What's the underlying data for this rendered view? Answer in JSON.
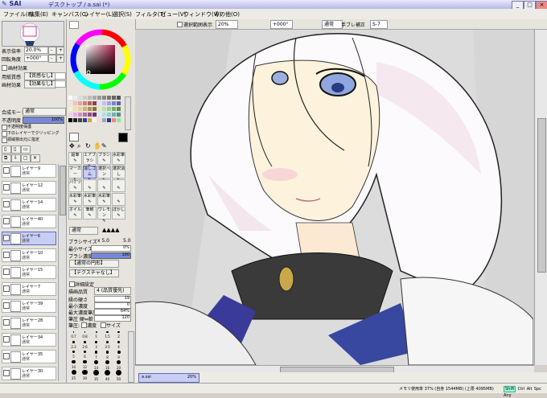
{
  "app": {
    "name": "SAI",
    "document_title": "デスクトップ / a.sai (*)",
    "window_buttons": [
      "_",
      "□",
      "×"
    ]
  },
  "menu": [
    "ファイル(F)",
    "編集(E)",
    "キャンバス(C)",
    "レイヤー(L)",
    "選択(S)",
    "フィルタ(T)",
    "ビュー(V)",
    "ウィンドウ(W)",
    "その他(O)"
  ],
  "toolbar": {
    "selection_outline_label": "選択範囲表示",
    "zoom_value": "20%",
    "rotation_value": "+000°",
    "blend_mode_value": "通常",
    "stabilizer_label": "手ブレ補正",
    "stabilizer_value": "S-7"
  },
  "navigator": {
    "zoom_label": "表示倍率",
    "zoom_value": "20.0%",
    "angle_label": "回転角度",
    "angle_value": "+000°"
  },
  "layer_effects": {
    "title": "画材効果",
    "paper_label": "用紙質感",
    "paper_value": "【質感なし】",
    "effect_label": "画材効果",
    "effect_value": "【効果なし】"
  },
  "layer_props": {
    "blend_label": "合成モード",
    "blend_value": "通常",
    "opacity_label": "不透明度",
    "opacity_value": "100%",
    "protect_label": "不透明度保護",
    "clip_label": "下のレイヤーでクリッピング",
    "ref_label": "領域検出元に指定"
  },
  "layers": [
    {
      "name": "レイヤー9",
      "mode": "通常",
      "opacity": "100%"
    },
    {
      "name": "レイヤー12",
      "mode": "通常",
      "opacity": "100%"
    },
    {
      "name": "レイヤー14",
      "mode": "通常",
      "opacity": "100%"
    },
    {
      "name": "レイヤー40",
      "mode": "通常",
      "opacity": "100%"
    },
    {
      "name": "レイヤー6",
      "mode": "通常",
      "opacity": "100%"
    },
    {
      "name": "レイヤー10",
      "mode": "通常",
      "opacity": "100%"
    },
    {
      "name": "レイヤー15",
      "mode": "通常",
      "opacity": "100%"
    },
    {
      "name": "レイヤー7",
      "mode": "通常",
      "opacity": "100%"
    },
    {
      "name": "レイヤー39",
      "mode": "通常",
      "opacity": "100%"
    },
    {
      "name": "レイヤー28",
      "mode": "通常",
      "opacity": "100%"
    },
    {
      "name": "レイヤー34",
      "mode": "通常",
      "opacity": "100%"
    },
    {
      "name": "レイヤー35",
      "mode": "通常",
      "opacity": "100%"
    },
    {
      "name": "レイヤー30",
      "mode": "通常",
      "opacity": "100%"
    }
  ],
  "selected_layer_index": 4,
  "tools": [
    [
      "鉛筆",
      "エアブラシ",
      "ブラシ",
      "水彩筆"
    ],
    [
      "マーカー",
      "消しゴム",
      "選択ペン",
      "選択消し"
    ],
    [
      "バケツ",
      "",
      "",
      ""
    ],
    [
      "水彩筆",
      "水彩筆",
      "水彩筆",
      ""
    ],
    [
      "オイル",
      "筆刷",
      "ワレモン",
      "ぼかし"
    ]
  ],
  "selected_tool": [
    1,
    1
  ],
  "brush": {
    "mode_label": "通常",
    "size_label": "ブラシサイズ",
    "size_mult": "x 5.0",
    "size_value": "5.0",
    "min_size_label": "最小サイズ",
    "min_size_value": "0%",
    "density_label": "ブラシ濃度",
    "density_value": "100",
    "shape_label": "【通常の円形】",
    "texture_label": "【テクスチャなし】",
    "detail_label": "詳細設定",
    "quality_label": "描画品質",
    "quality_value": "4 (品質優先)",
    "edge_label": "縁の硬さ",
    "edge_value": "19",
    "min_density_label": "最小濃度",
    "min_density_value": "0",
    "max_pressure_label": "最大濃度筆圧",
    "max_pressure_value": "64%",
    "pressure_label": "筆圧 硬⇔軟",
    "pressure_value": "120",
    "pressure2_label": "筆圧:",
    "density_chk": "濃度",
    "size_chk": "サイズ"
  },
  "brush_sizes": [
    "0.7",
    "0.8",
    "1",
    "1.5",
    "2",
    "2.3",
    "2.6",
    "3",
    "3.5",
    "4",
    "5",
    "6",
    "7",
    "8",
    "9",
    "10",
    "12",
    "14",
    "16",
    "20",
    "25",
    "30",
    "35",
    "40",
    "50"
  ],
  "nav_tab": {
    "name": "a.sai",
    "zoom": "20%"
  },
  "status": {
    "memory": "メモリ使用率 37% (自身 1544MB) (上限 4095MB)",
    "indicators": [
      "Shift",
      "Ctrl",
      "Alt",
      "Spc",
      "Any"
    ]
  },
  "colors": {
    "accent": "#6068c0",
    "title_gradient": "#b8b8e8",
    "selection": "#c8cdf4"
  }
}
